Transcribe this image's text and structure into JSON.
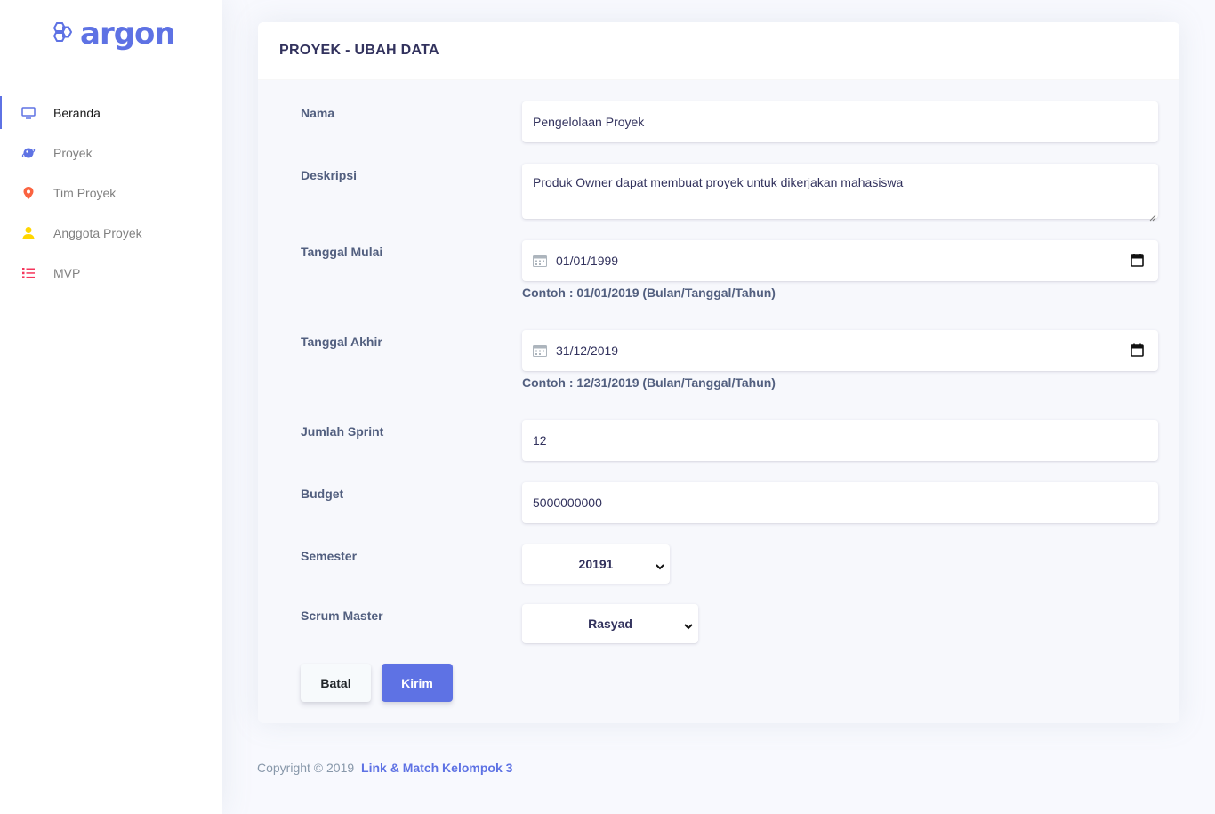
{
  "brand": {
    "name": "argon",
    "icon": "hexagon-logo-icon"
  },
  "sidebar": {
    "items": [
      {
        "label": "Beranda",
        "icon": "tv-icon",
        "color": "#5e72e4",
        "active": true
      },
      {
        "label": "Proyek",
        "icon": "planet-icon",
        "color": "#5e72e4",
        "active": false
      },
      {
        "label": "Tim Proyek",
        "icon": "pin-icon",
        "color": "#fb6340",
        "active": false
      },
      {
        "label": "Anggota Proyek",
        "icon": "user-icon",
        "color": "#ffd600",
        "active": false
      },
      {
        "label": "MVP",
        "icon": "list-icon",
        "color": "#f5365c",
        "active": false
      }
    ]
  },
  "form": {
    "title": "PROYEK - UBAH DATA",
    "nama": {
      "label": "Nama",
      "value": "Pengelolaan Proyek"
    },
    "deskripsi": {
      "label": "Deskripsi",
      "value": "Produk Owner dapat membuat proyek untuk dikerjakan mahasiswa"
    },
    "tanggal_mulai": {
      "label": "Tanggal Mulai",
      "value": "01/01/1999",
      "hint": "Contoh : 01/01/2019 (Bulan/Tanggal/Tahun)"
    },
    "tanggal_akhir": {
      "label": "Tanggal Akhir",
      "value": "31/12/2019",
      "hint": "Contoh : 12/31/2019 (Bulan/Tanggal/Tahun)"
    },
    "jumlah_sprint": {
      "label": "Jumlah Sprint",
      "value": "12"
    },
    "budget": {
      "label": "Budget",
      "value": "5000000000"
    },
    "semester": {
      "label": "Semester",
      "value": "20191"
    },
    "scrum_master": {
      "label": "Scrum Master",
      "value": "Rasyad"
    },
    "cancel_label": "Batal",
    "submit_label": "Kirim"
  },
  "footer": {
    "copyright": "Copyright © 2019",
    "link": "Link & Match Kelompok 3"
  },
  "colors": {
    "primary": "#5e72e4",
    "background": "#f8f9fe"
  }
}
